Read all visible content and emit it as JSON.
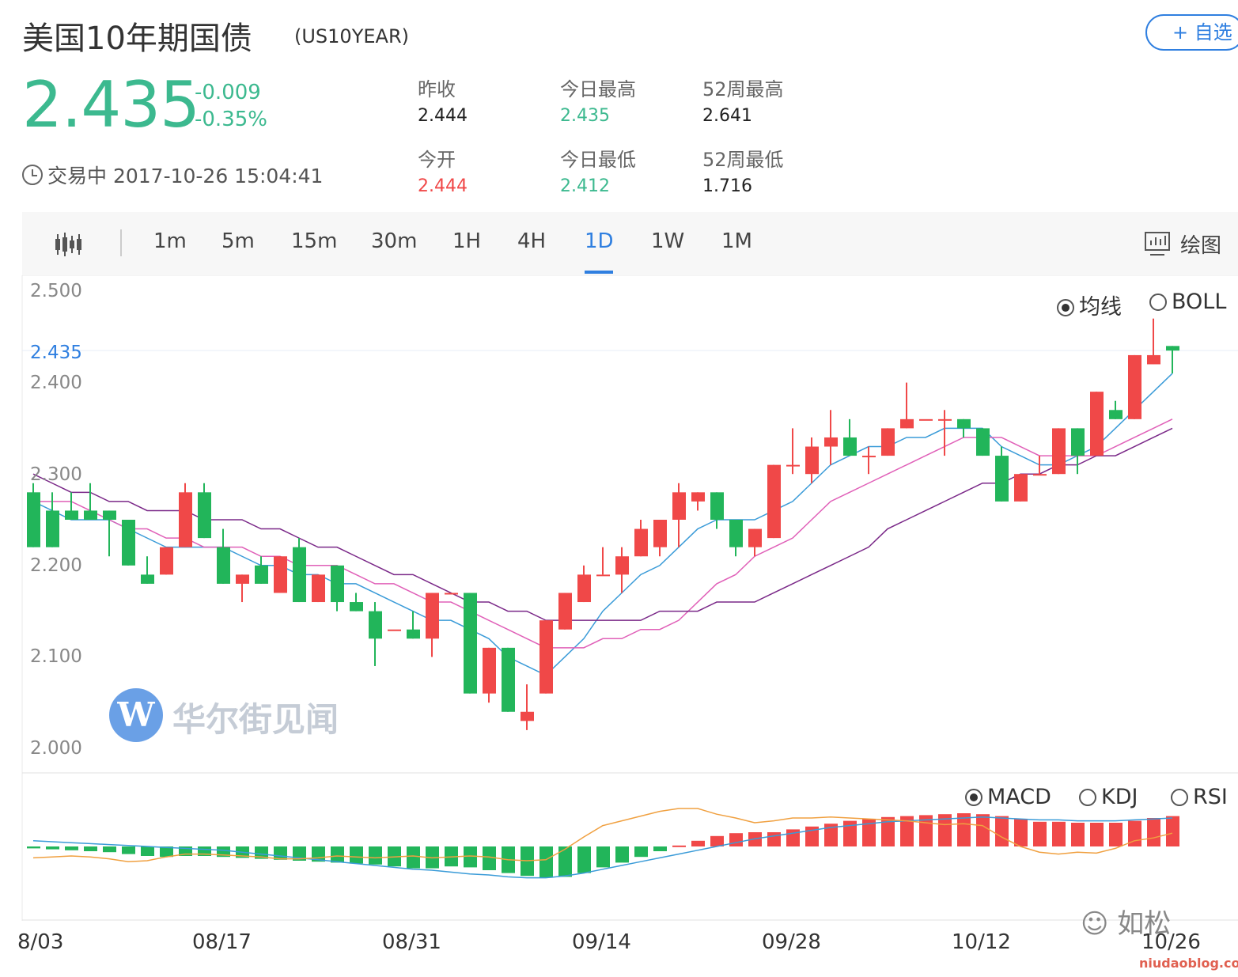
{
  "header": {
    "title": "美国10年期国债",
    "code": "(US10YEAR)",
    "watch_label": "+ 自选",
    "price": "2.435",
    "change": "-0.009",
    "change_pct": "-0.35%",
    "status_time": "交易中 2017-10-26 15:04:41",
    "colors": {
      "down": "#3cb98f",
      "up": "#f04848",
      "accent": "#2f7fe0"
    }
  },
  "stats": [
    {
      "label": "昨收",
      "value": "2.444",
      "color": "#222222"
    },
    {
      "label": "今日最高",
      "value": "2.435",
      "color": "#3cb98f"
    },
    {
      "label": "52周最高",
      "value": "2.641",
      "color": "#222222"
    },
    {
      "label": "今开",
      "value": "2.444",
      "color": "#f04848"
    },
    {
      "label": "今日最低",
      "value": "2.412",
      "color": "#3cb98f"
    },
    {
      "label": "52周最低",
      "value": "1.716",
      "color": "#222222"
    }
  ],
  "toolbar": {
    "chart_icon": "candlestick-icon",
    "periods": [
      "1m",
      "5m",
      "15m",
      "30m",
      "1H",
      "4H",
      "1D",
      "1W",
      "1M"
    ],
    "active_period": "1D",
    "draw_label": "绘图",
    "draw_icon": "drawing-icon"
  },
  "overlay_options": {
    "ma": "均线",
    "boll": "BOLL",
    "selected": "均线"
  },
  "indicator_options": {
    "macd": "MACD",
    "kdj": "KDJ",
    "rsi": "RSI",
    "selected": "MACD"
  },
  "watermark": "华尔街见闻",
  "wechat_label": "如松",
  "site_label": "niudaoblog.com",
  "chart_data": {
    "type": "candlestick",
    "ylim": [
      2.0,
      2.5
    ],
    "y_ticks": [
      "2.500",
      "2.400",
      "2.300",
      "2.200",
      "2.100",
      "2.000"
    ],
    "last_price_label": "2.435",
    "x_tick_labels": [
      "8/03",
      "08/17",
      "08/31",
      "09/14",
      "09/28",
      "10/12",
      "10/26"
    ],
    "x_tick_indices": [
      0,
      10,
      20,
      30,
      40,
      50,
      60
    ],
    "candles": [
      [
        2.28,
        2.22,
        2.29,
        2.22
      ],
      [
        2.26,
        2.22,
        2.28,
        2.22
      ],
      [
        2.26,
        2.25,
        2.28,
        2.25
      ],
      [
        2.26,
        2.25,
        2.29,
        2.25
      ],
      [
        2.26,
        2.25,
        2.26,
        2.21
      ],
      [
        2.25,
        2.2,
        2.25,
        2.2
      ],
      [
        2.19,
        2.18,
        2.21,
        2.18
      ],
      [
        2.19,
        2.22,
        2.22,
        2.19
      ],
      [
        2.22,
        2.28,
        2.29,
        2.22
      ],
      [
        2.28,
        2.23,
        2.29,
        2.23
      ],
      [
        2.22,
        2.18,
        2.24,
        2.18
      ],
      [
        2.18,
        2.19,
        2.19,
        2.16
      ],
      [
        2.2,
        2.18,
        2.21,
        2.18
      ],
      [
        2.17,
        2.21,
        2.21,
        2.17
      ],
      [
        2.22,
        2.16,
        2.23,
        2.16
      ],
      [
        2.16,
        2.19,
        2.19,
        2.16
      ],
      [
        2.2,
        2.16,
        2.2,
        2.15
      ],
      [
        2.16,
        2.15,
        2.17,
        2.15
      ],
      [
        2.15,
        2.12,
        2.16,
        2.09
      ],
      [
        2.13,
        2.13,
        2.13,
        2.13
      ],
      [
        2.13,
        2.12,
        2.15,
        2.12
      ],
      [
        2.12,
        2.17,
        2.17,
        2.1
      ],
      [
        2.17,
        2.17,
        2.17,
        2.17
      ],
      [
        2.17,
        2.06,
        2.17,
        2.06
      ],
      [
        2.06,
        2.11,
        2.11,
        2.05
      ],
      [
        2.11,
        2.04,
        2.11,
        2.04
      ],
      [
        2.03,
        2.04,
        2.07,
        2.02
      ],
      [
        2.06,
        2.14,
        2.14,
        2.06
      ],
      [
        2.13,
        2.17,
        2.17,
        2.13
      ],
      [
        2.16,
        2.19,
        2.2,
        2.16
      ],
      [
        2.19,
        2.19,
        2.22,
        2.19
      ],
      [
        2.19,
        2.21,
        2.22,
        2.17
      ],
      [
        2.21,
        2.24,
        2.25,
        2.21
      ],
      [
        2.22,
        2.25,
        2.25,
        2.21
      ],
      [
        2.25,
        2.28,
        2.29,
        2.22
      ],
      [
        2.27,
        2.28,
        2.28,
        2.26
      ],
      [
        2.28,
        2.25,
        2.28,
        2.24
      ],
      [
        2.25,
        2.22,
        2.25,
        2.21
      ],
      [
        2.22,
        2.24,
        2.24,
        2.21
      ],
      [
        2.23,
        2.31,
        2.31,
        2.23
      ],
      [
        2.31,
        2.31,
        2.35,
        2.3
      ],
      [
        2.3,
        2.33,
        2.34,
        2.29
      ],
      [
        2.33,
        2.34,
        2.37,
        2.31
      ],
      [
        2.34,
        2.32,
        2.36,
        2.32
      ],
      [
        2.32,
        2.32,
        2.33,
        2.3
      ],
      [
        2.32,
        2.35,
        2.35,
        2.32
      ],
      [
        2.35,
        2.36,
        2.4,
        2.35
      ],
      [
        2.36,
        2.36,
        2.36,
        2.36
      ],
      [
        2.36,
        2.36,
        2.37,
        2.32
      ],
      [
        2.36,
        2.35,
        2.36,
        2.34
      ],
      [
        2.35,
        2.32,
        2.35,
        2.32
      ],
      [
        2.32,
        2.27,
        2.33,
        2.27
      ],
      [
        2.27,
        2.3,
        2.3,
        2.27
      ],
      [
        2.3,
        2.3,
        2.32,
        2.3
      ],
      [
        2.3,
        2.35,
        2.35,
        2.3
      ],
      [
        2.35,
        2.32,
        2.35,
        2.3
      ],
      [
        2.32,
        2.39,
        2.39,
        2.32
      ],
      [
        2.37,
        2.36,
        2.38,
        2.36
      ],
      [
        2.36,
        2.43,
        2.43,
        2.36
      ],
      [
        2.42,
        2.43,
        2.47,
        2.42
      ],
      [
        2.44,
        2.435,
        2.44,
        2.41
      ]
    ],
    "ma_series": [
      {
        "color": "#3a9bd8",
        "values": [
          2.27,
          2.26,
          2.25,
          2.25,
          2.25,
          2.24,
          2.23,
          2.22,
          2.22,
          2.22,
          2.22,
          2.21,
          2.2,
          2.2,
          2.19,
          2.19,
          2.18,
          2.18,
          2.17,
          2.16,
          2.15,
          2.14,
          2.14,
          2.13,
          2.12,
          2.1,
          2.09,
          2.08,
          2.1,
          2.12,
          2.15,
          2.17,
          2.19,
          2.2,
          2.22,
          2.24,
          2.25,
          2.25,
          2.25,
          2.26,
          2.27,
          2.29,
          2.31,
          2.32,
          2.33,
          2.33,
          2.34,
          2.34,
          2.35,
          2.35,
          2.35,
          2.33,
          2.32,
          2.31,
          2.31,
          2.32,
          2.33,
          2.35,
          2.37,
          2.39,
          2.41
        ]
      },
      {
        "color": "#e060b8",
        "values": [
          2.27,
          2.27,
          2.27,
          2.26,
          2.25,
          2.24,
          2.24,
          2.23,
          2.23,
          2.22,
          2.22,
          2.22,
          2.21,
          2.21,
          2.2,
          2.2,
          2.2,
          2.19,
          2.18,
          2.18,
          2.17,
          2.16,
          2.16,
          2.15,
          2.14,
          2.13,
          2.12,
          2.11,
          2.11,
          2.11,
          2.12,
          2.12,
          2.13,
          2.13,
          2.14,
          2.16,
          2.18,
          2.19,
          2.21,
          2.22,
          2.23,
          2.25,
          2.27,
          2.28,
          2.29,
          2.3,
          2.31,
          2.32,
          2.33,
          2.34,
          2.34,
          2.34,
          2.33,
          2.32,
          2.32,
          2.32,
          2.32,
          2.33,
          2.34,
          2.35,
          2.36
        ]
      },
      {
        "color": "#7a2888",
        "values": [
          2.3,
          2.29,
          2.28,
          2.28,
          2.27,
          2.27,
          2.26,
          2.26,
          2.26,
          2.25,
          2.25,
          2.25,
          2.24,
          2.24,
          2.23,
          2.22,
          2.22,
          2.21,
          2.2,
          2.19,
          2.19,
          2.18,
          2.17,
          2.16,
          2.16,
          2.15,
          2.15,
          2.14,
          2.14,
          2.14,
          2.14,
          2.14,
          2.14,
          2.15,
          2.15,
          2.15,
          2.16,
          2.16,
          2.16,
          2.17,
          2.18,
          2.19,
          2.2,
          2.21,
          2.22,
          2.24,
          2.25,
          2.26,
          2.27,
          2.28,
          2.29,
          2.29,
          2.3,
          2.3,
          2.31,
          2.31,
          2.32,
          2.32,
          2.33,
          2.34,
          2.35
        ]
      }
    ],
    "macd": {
      "histogram": [
        -0.002,
        -0.003,
        -0.004,
        -0.005,
        -0.006,
        -0.008,
        -0.01,
        -0.011,
        -0.01,
        -0.01,
        -0.011,
        -0.012,
        -0.013,
        -0.014,
        -0.015,
        -0.016,
        -0.017,
        -0.018,
        -0.019,
        -0.021,
        -0.023,
        -0.023,
        -0.021,
        -0.022,
        -0.025,
        -0.028,
        -0.031,
        -0.033,
        -0.032,
        -0.028,
        -0.022,
        -0.017,
        -0.011,
        -0.005,
        0.001,
        0.006,
        0.011,
        0.014,
        0.015,
        0.015,
        0.018,
        0.021,
        0.024,
        0.027,
        0.029,
        0.031,
        0.032,
        0.033,
        0.034,
        0.035,
        0.034,
        0.032,
        0.029,
        0.026,
        0.026,
        0.025,
        0.025,
        0.025,
        0.027,
        0.03,
        0.032
      ],
      "dif": [
        0.006,
        0.005,
        0.004,
        0.003,
        0.002,
        0.001,
        0.0,
        -0.001,
        -0.002,
        -0.003,
        -0.004,
        -0.006,
        -0.008,
        -0.01,
        -0.012,
        -0.014,
        -0.016,
        -0.018,
        -0.02,
        -0.022,
        -0.024,
        -0.025,
        -0.027,
        -0.029,
        -0.03,
        -0.032,
        -0.033,
        -0.033,
        -0.031,
        -0.028,
        -0.024,
        -0.02,
        -0.016,
        -0.012,
        -0.008,
        -0.004,
        0.0,
        0.004,
        0.008,
        0.011,
        0.014,
        0.017,
        0.02,
        0.022,
        0.024,
        0.026,
        0.027,
        0.028,
        0.029,
        0.03,
        0.031,
        0.03,
        0.029,
        0.028,
        0.028,
        0.027,
        0.027,
        0.027,
        0.028,
        0.029,
        0.03
      ],
      "dea": [
        -0.012,
        -0.011,
        -0.01,
        -0.011,
        -0.013,
        -0.016,
        -0.015,
        -0.011,
        -0.008,
        -0.008,
        -0.009,
        -0.01,
        -0.011,
        -0.013,
        -0.013,
        -0.012,
        -0.01,
        -0.011,
        -0.012,
        -0.011,
        -0.01,
        -0.012,
        -0.011,
        -0.01,
        -0.011,
        -0.014,
        -0.015,
        -0.014,
        -0.003,
        0.01,
        0.022,
        0.027,
        0.032,
        0.037,
        0.04,
        0.04,
        0.034,
        0.03,
        0.025,
        0.027,
        0.03,
        0.03,
        0.031,
        0.03,
        0.029,
        0.028,
        0.027,
        0.025,
        0.023,
        0.024,
        0.022,
        0.01,
        0.0,
        -0.006,
        -0.008,
        -0.006,
        -0.007,
        -0.002,
        0.006,
        0.009,
        0.014
      ],
      "dif_color": "#3a9bd8",
      "dea_color": "#f0a040"
    }
  }
}
